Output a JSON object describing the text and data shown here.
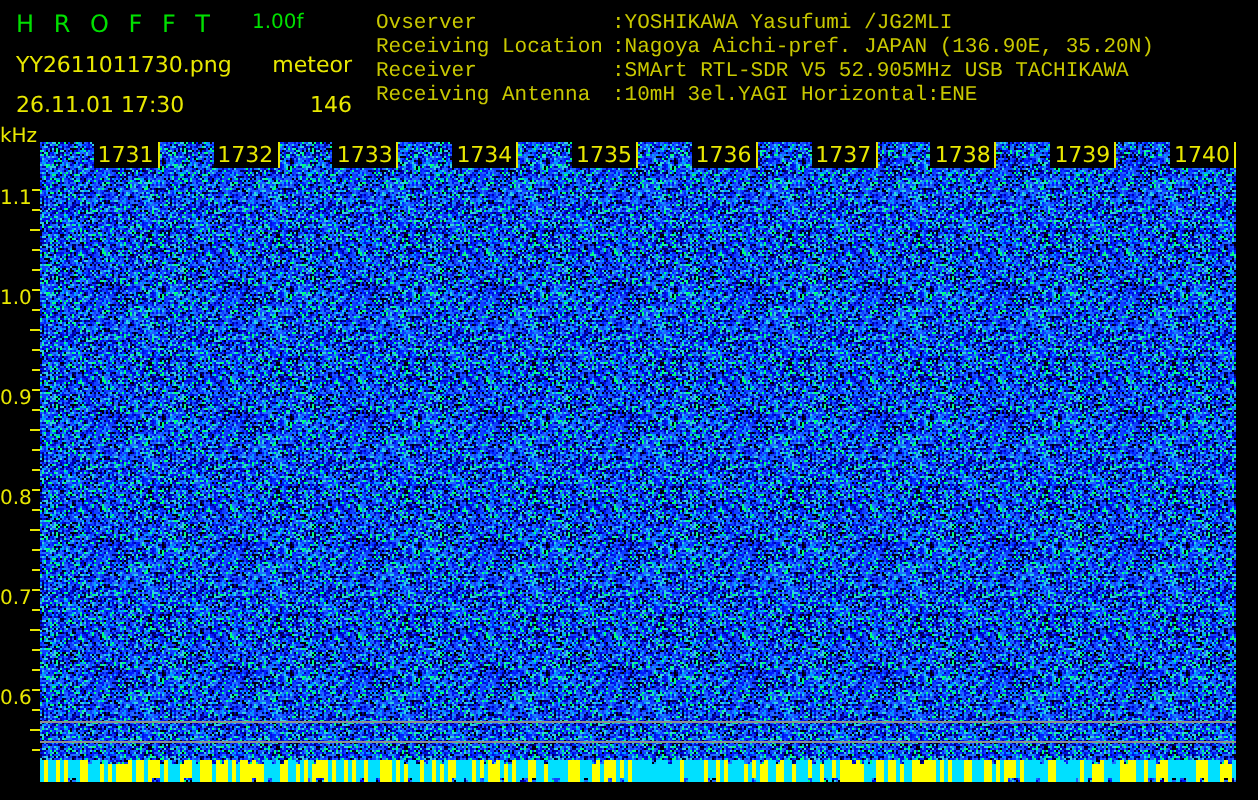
{
  "header": {
    "app_title": "H R O F F T",
    "version": "1.00f",
    "filename": "YY2611011730.png",
    "datetime": "26.11.01 17:30",
    "mode": "meteor",
    "count": "146"
  },
  "info": [
    {
      "label": "Ovserver",
      "value": ":YOSHIKAWA Yasufumi /JG2MLI"
    },
    {
      "label": "Receiving Location",
      "value": ":Nagoya Aichi-pref. JAPAN (136.90E, 35.20N)"
    },
    {
      "label": "Receiver",
      "value": ":SMArt RTL-SDR V5 52.905MHz USB TACHIKAWA"
    },
    {
      "label": "Receiving Antenna",
      "value": ":10mH 3el.YAGI Horizontal:ENE"
    }
  ],
  "spectrogram": {
    "unit": "kHz",
    "time_labels": [
      "1731",
      "1732",
      "1733",
      "1734",
      "1735",
      "1736",
      "1737",
      "1738",
      "1739",
      "1740"
    ],
    "freq_labels": [
      "1.1",
      "1.0",
      "0.9",
      "0.8",
      "0.7",
      "0.6"
    ]
  }
}
